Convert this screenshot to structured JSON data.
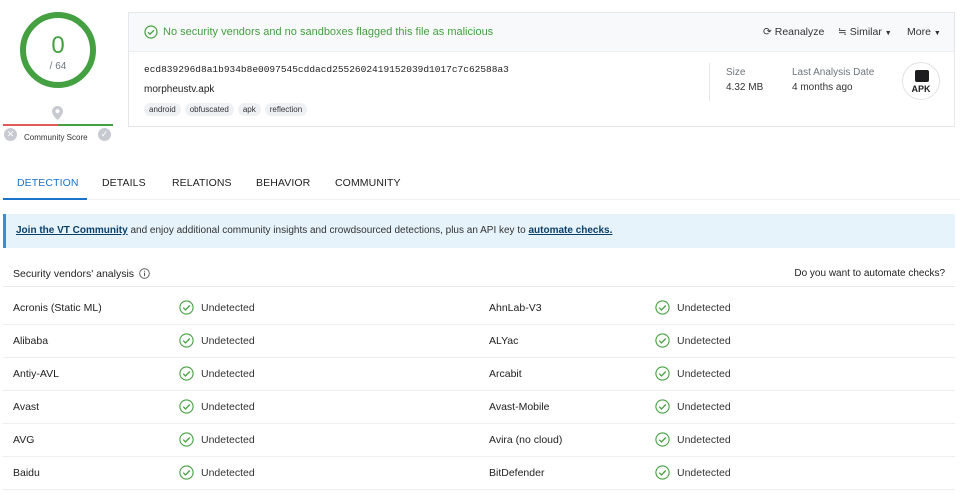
{
  "score": {
    "detections": "0",
    "total": "/ 64",
    "community_label": "Community Score",
    "color_good": "#45a041",
    "color_bad": "#e25a5a"
  },
  "banner": {
    "status_text": "No security vendors and no sandboxes flagged this file as malicious",
    "reanalyze": "Reanalyze",
    "similar": "Similar",
    "more": "More"
  },
  "file": {
    "hash": "ecd839296d8a1b934b8e0097545cddacd2552602419152039d1017c7c62588a3",
    "name": "morpheustv.apk",
    "tags": [
      "android",
      "obfuscated",
      "apk",
      "reflection"
    ],
    "size_label": "Size",
    "size_value": "4.32 MB",
    "last_analysis_label": "Last Analysis Date",
    "last_analysis_value": "4 months ago",
    "type_badge": "APK"
  },
  "tabs": [
    "DETECTION",
    "DETAILS",
    "RELATIONS",
    "BEHAVIOR",
    "COMMUNITY"
  ],
  "info_banner": {
    "link1": "Join the VT Community",
    "middle": " and enjoy additional community insights and crowdsourced detections, plus an API key to ",
    "link2": "automate checks."
  },
  "vendors": {
    "title": "Security vendors' analysis",
    "automate": "Do you want to automate checks?",
    "rows": [
      {
        "left_name": "Acronis (Static ML)",
        "left_result": "Undetected",
        "right_name": "AhnLab-V3",
        "right_result": "Undetected"
      },
      {
        "left_name": "Alibaba",
        "left_result": "Undetected",
        "right_name": "ALYac",
        "right_result": "Undetected"
      },
      {
        "left_name": "Antiy-AVL",
        "left_result": "Undetected",
        "right_name": "Arcabit",
        "right_result": "Undetected"
      },
      {
        "left_name": "Avast",
        "left_result": "Undetected",
        "right_name": "Avast-Mobile",
        "right_result": "Undetected"
      },
      {
        "left_name": "AVG",
        "left_result": "Undetected",
        "right_name": "Avira (no cloud)",
        "right_result": "Undetected"
      },
      {
        "left_name": "Baidu",
        "left_result": "Undetected",
        "right_name": "BitDefender",
        "right_result": "Undetected"
      }
    ]
  },
  "colors": {
    "accent": "#1a73c8",
    "ok": "#45a041",
    "info_bg": "#e6f3fb"
  },
  "icons": [
    "check-circle-icon",
    "location-pin-icon",
    "x-circle-icon",
    "reanalyze-icon",
    "similar-icon",
    "chevron-down-icon",
    "apk-file-icon",
    "info-icon"
  ]
}
